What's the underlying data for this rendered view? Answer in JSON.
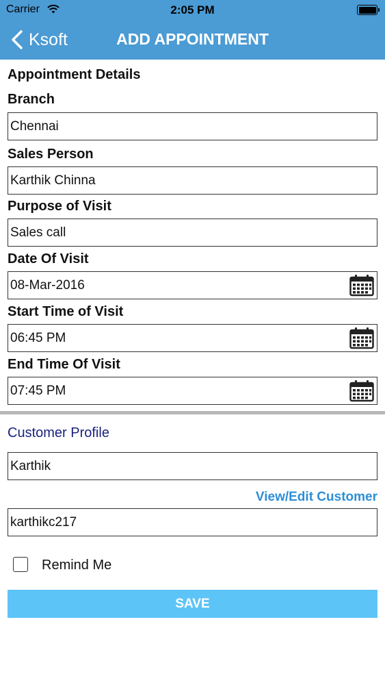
{
  "status_bar": {
    "carrier": "Carrier",
    "time": "2:05 PM",
    "wifi_icon": "wifi-icon",
    "battery_icon": "battery-icon",
    "battery_level": 1.0
  },
  "nav": {
    "back_label": "Ksoft",
    "title": "ADD APPOINTMENT",
    "background_color": "#4b9bd4"
  },
  "appointment": {
    "section_title": "Appointment Details",
    "branch": {
      "label": "Branch",
      "value": "Chennai"
    },
    "sales_person": {
      "label": "Sales Person",
      "value": "Karthik Chinna"
    },
    "purpose": {
      "label": "Purpose of Visit",
      "value": "Sales call"
    },
    "date": {
      "label": "Date Of Visit",
      "value": "08-Mar-2016",
      "icon": "calendar-icon"
    },
    "start_time": {
      "label": "Start Time of Visit",
      "value": "06:45 PM",
      "icon": "calendar-icon"
    },
    "end_time": {
      "label": "End Time Of Visit",
      "value": "07:45 PM",
      "icon": "calendar-icon"
    }
  },
  "customer": {
    "section_title": "Customer Profile",
    "name_value": "Karthik",
    "view_edit_label": "View/Edit Customer",
    "id_value": "karthikc217"
  },
  "remind": {
    "label": "Remind Me",
    "checked": false
  },
  "save": {
    "label": "SAVE",
    "color": "#5dc4f7"
  }
}
